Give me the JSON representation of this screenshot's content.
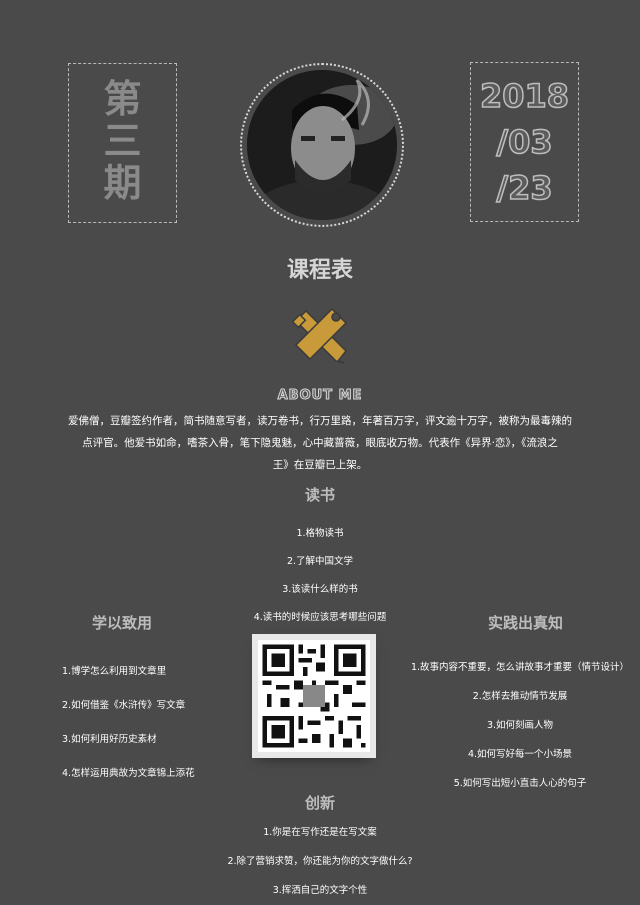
{
  "issue": {
    "chars": [
      "第",
      "三",
      "期"
    ]
  },
  "date": {
    "lines": [
      "2018",
      "/03",
      "/23"
    ]
  },
  "course_title": "课程表",
  "about_heading": "ABOUT ME",
  "about_text": [
    "爱佛僧，豆瓣签约作者，简书随意写者，读万卷书，行万里路，年著百万字，评文逾十万字，被称为最毒辣的",
    "点评官。他爱书如命，嗜茶入骨，笔下隐鬼魅，心中藏蔷薇，眼底收万物。代表作《异界·恋》，《流浪之",
    "王》在豆瓣已上架。"
  ],
  "reading": {
    "heading": "读书",
    "items": [
      "1.格物读书",
      "2.了解中国文学",
      "3.该读什么样的书",
      "4.读书的时候应该思考哪些问题"
    ]
  },
  "apply": {
    "heading": "学以致用",
    "items": [
      "1.博学怎么利用到文章里",
      "2.如何借鉴《水浒传》写文章",
      "3.如何利用好历史素材",
      "4.怎样运用典故为文章锦上添花"
    ]
  },
  "practice": {
    "heading": "实践出真知",
    "items": [
      "1.故事内容不重要，怎么讲故事才重要（情节设计）",
      "2.怎样去推动情节发展",
      "3.如何刻画人物",
      "4.如何写好每一个小场景",
      "5.如何写出短小直击人心的句子"
    ]
  },
  "innovate": {
    "heading": "创新",
    "items": [
      "1.你是在写作还是在写文案",
      "2.除了营销求赞，你还能为你的文字做什么?",
      "3.挥洒自己的文字个性"
    ]
  },
  "colors": {
    "background": "#4a4a4a",
    "icon_gold": "#c99a3a"
  }
}
